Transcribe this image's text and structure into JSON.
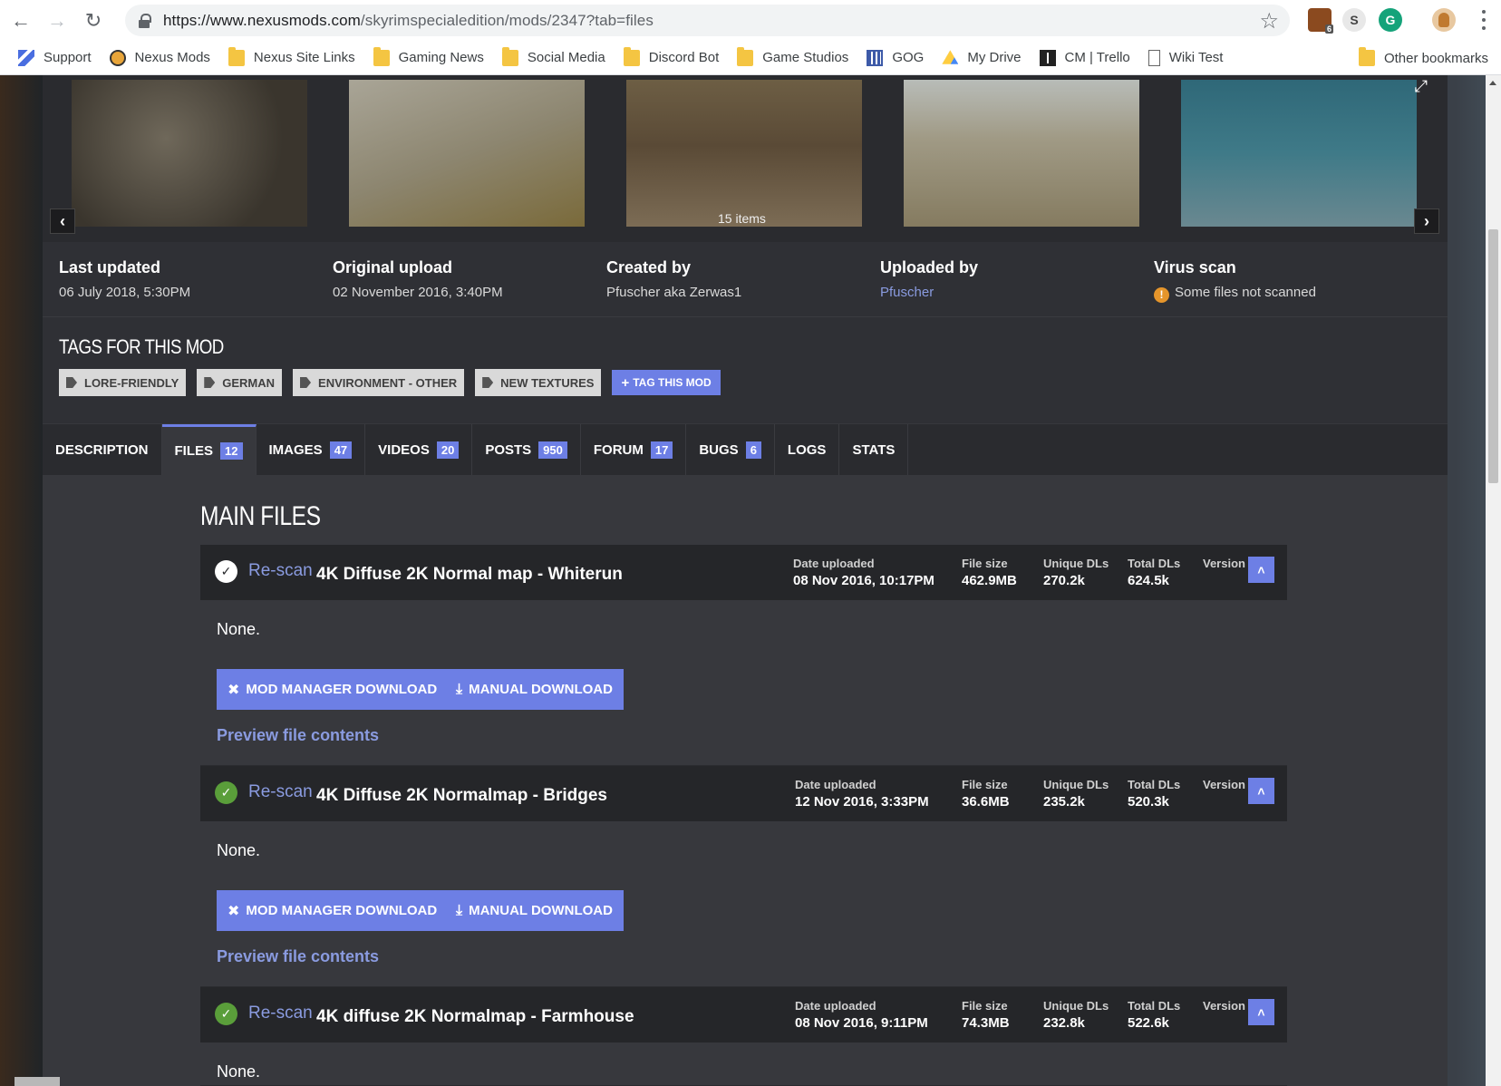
{
  "browser": {
    "url_host": "https://www.nexusmods.com",
    "url_path": "/skyrimspecialedition/mods/2347?tab=files",
    "ext_badge": "6",
    "bookmarks": [
      "Support",
      "Nexus Mods",
      "Nexus Site Links",
      "Gaming News",
      "Social Media",
      "Discord Bot",
      "Game Studios",
      "GOG",
      "My Drive",
      "CM | Trello",
      "Wiki Test"
    ],
    "other_bookmarks": "Other bookmarks"
  },
  "gallery": {
    "items_label": "15 items",
    "colors": [
      "#5b5448",
      "#8a8470",
      "#6b5e48",
      "#9a9580",
      "#3f6e78"
    ]
  },
  "meta": {
    "last_updated_label": "Last updated",
    "last_updated": "06 July 2018,  5:30PM",
    "original_upload_label": "Original upload",
    "original_upload": "02 November 2016,  3:40PM",
    "created_by_label": "Created by",
    "created_by": "Pfuscher aka Zerwas1",
    "uploaded_by_label": "Uploaded by",
    "uploaded_by": "Pfuscher",
    "virus_scan_label": "Virus scan",
    "virus_scan": "Some files not scanned"
  },
  "tags": {
    "title": "TAGS FOR THIS MOD",
    "items": [
      "LORE-FRIENDLY",
      "GERMAN",
      "ENVIRONMENT - OTHER",
      "NEW TEXTURES"
    ],
    "add_label": "TAG THIS MOD"
  },
  "tabs": [
    {
      "label": "DESCRIPTION",
      "count": ""
    },
    {
      "label": "FILES",
      "count": "12"
    },
    {
      "label": "IMAGES",
      "count": "47"
    },
    {
      "label": "VIDEOS",
      "count": "20"
    },
    {
      "label": "POSTS",
      "count": "950"
    },
    {
      "label": "FORUM",
      "count": "17"
    },
    {
      "label": "BUGS",
      "count": "6"
    },
    {
      "label": "LOGS",
      "count": ""
    },
    {
      "label": "STATS",
      "count": ""
    }
  ],
  "main_files_title": "MAIN FILES",
  "labels": {
    "rescan": "Re-scan",
    "date_uploaded": "Date uploaded",
    "file_size": "File size",
    "unique_dls": "Unique DLs",
    "total_dls": "Total DLs",
    "version": "Version",
    "mod_manager_download": "MOD MANAGER DOWNLOAD",
    "manual_download": "MANUAL DOWNLOAD",
    "preview": "Preview file contents"
  },
  "files": [
    {
      "name": "4K Diffuse 2K Normal map - Whiterun",
      "date": "08 Nov 2016, 10:17PM",
      "size": "462.9MB",
      "unique": "270.2k",
      "total": "624.5k",
      "description": "None.",
      "scanned": false
    },
    {
      "name": "4K Diffuse 2K Normalmap - Bridges",
      "date": "12 Nov 2016, 3:33PM",
      "size": "36.6MB",
      "unique": "235.2k",
      "total": "520.3k",
      "description": "None.",
      "scanned": true
    },
    {
      "name": "4K diffuse 2K Normalmap - Farmhouse",
      "date": "08 Nov 2016, 9:11PM",
      "size": "74.3MB",
      "unique": "232.8k",
      "total": "522.6k",
      "description": "None.",
      "scanned": true
    }
  ],
  "colors": {
    "accent": "#6d7fe5",
    "link": "#8a9be0",
    "scanned_green": "#5a9e3a",
    "warning": "#e5952b"
  }
}
